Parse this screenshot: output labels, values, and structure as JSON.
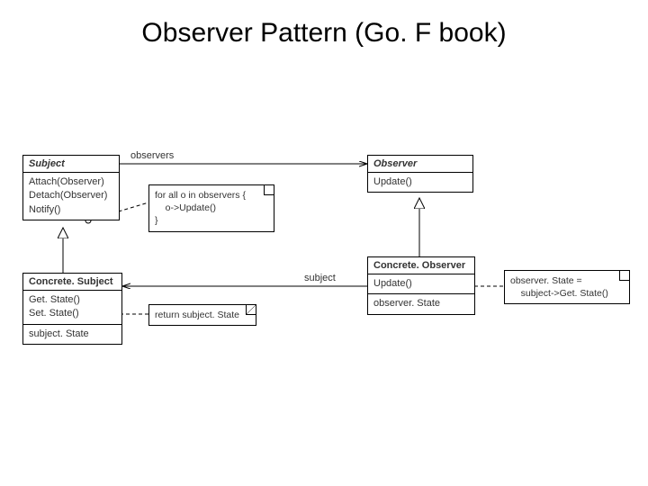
{
  "title": "Observer Pattern (Go. F book)",
  "labels": {
    "observers": "observers",
    "subject": "subject"
  },
  "classes": {
    "subject": {
      "name": "Subject",
      "ops": [
        "Attach(Observer)",
        "Detach(Observer)",
        "Notify()"
      ]
    },
    "observer": {
      "name": "Observer",
      "ops": [
        "Update()"
      ]
    },
    "concreteSubject": {
      "name": "Concrete. Subject",
      "ops": [
        "Get. State()",
        "Set. State()"
      ],
      "attrs": [
        "subject. State"
      ]
    },
    "concreteObserver": {
      "name": "Concrete. Observer",
      "ops": [
        "Update()"
      ],
      "attrs": [
        "observer. State"
      ]
    }
  },
  "notes": {
    "notify": [
      "for all o in observers {",
      "    o->Update()",
      "}"
    ],
    "getstate": "return subject. State",
    "update": [
      "observer. State =",
      "    subject->Get. State()"
    ]
  }
}
